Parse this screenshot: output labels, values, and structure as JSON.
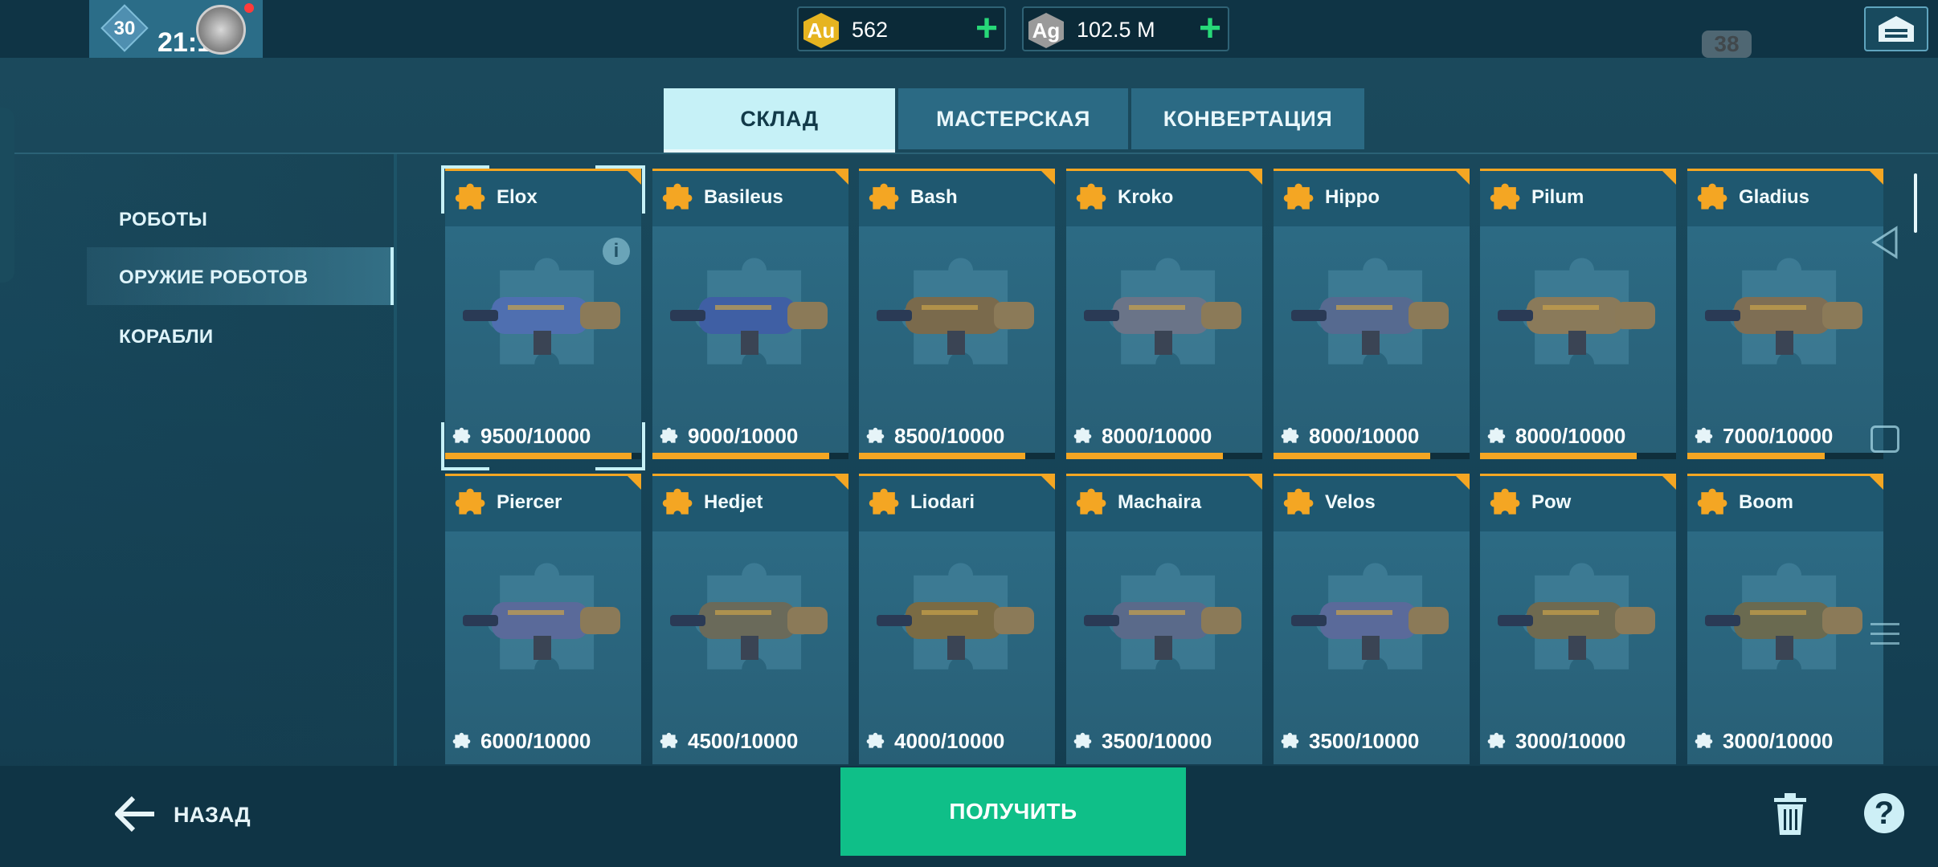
{
  "player": {
    "level": "30",
    "timer": "21:13",
    "emblem_icon": "eagle-emblem-icon"
  },
  "currencies": [
    {
      "code": "Au",
      "value": "562",
      "color": "#e6b420"
    },
    {
      "code": "Ag",
      "value": "102.5 M",
      "color": "#9a9a9a"
    }
  ],
  "top_counter": "38",
  "tabs": [
    {
      "label": "СКЛАД",
      "active": true
    },
    {
      "label": "МАСТЕРСКАЯ",
      "active": false
    },
    {
      "label": "КОНВЕРТАЦИЯ",
      "active": false
    }
  ],
  "categories": [
    {
      "label": "РОБОТЫ",
      "selected": false
    },
    {
      "label": "ОРУЖИЕ РОБОТОВ",
      "selected": true
    },
    {
      "label": "КОРАБЛИ",
      "selected": false
    }
  ],
  "items": [
    {
      "name": "Elox",
      "count": "9500/10000",
      "progress": 0.95,
      "selected": true
    },
    {
      "name": "Basileus",
      "count": "9000/10000",
      "progress": 0.9
    },
    {
      "name": "Bash",
      "count": "8500/10000",
      "progress": 0.85
    },
    {
      "name": "Kroko",
      "count": "8000/10000",
      "progress": 0.8
    },
    {
      "name": "Hippo",
      "count": "8000/10000",
      "progress": 0.8
    },
    {
      "name": "Pilum",
      "count": "8000/10000",
      "progress": 0.8
    },
    {
      "name": "Gladius",
      "count": "7000/10000",
      "progress": 0.7
    },
    {
      "name": "Piercer",
      "count": "6000/10000",
      "progress": 0.6
    },
    {
      "name": "Hedjet",
      "count": "4500/10000",
      "progress": 0.45
    },
    {
      "name": "Liodari",
      "count": "4000/10000",
      "progress": 0.4
    },
    {
      "name": "Machaira",
      "count": "3500/10000",
      "progress": 0.35
    },
    {
      "name": "Velos",
      "count": "3500/10000",
      "progress": 0.35
    },
    {
      "name": "Pow",
      "count": "3000/10000",
      "progress": 0.3
    },
    {
      "name": "Boom",
      "count": "3000/10000",
      "progress": 0.3
    }
  ],
  "info_glyph": "i",
  "footer": {
    "back_label": "НАЗАД",
    "get_label": "ПОЛУЧИТЬ",
    "help_glyph": "?"
  },
  "colors": {
    "accent_orange": "#f4a623",
    "get_button": "#0fbf88",
    "active_tab": "#c6f1f7",
    "plus_green": "#27d878"
  }
}
